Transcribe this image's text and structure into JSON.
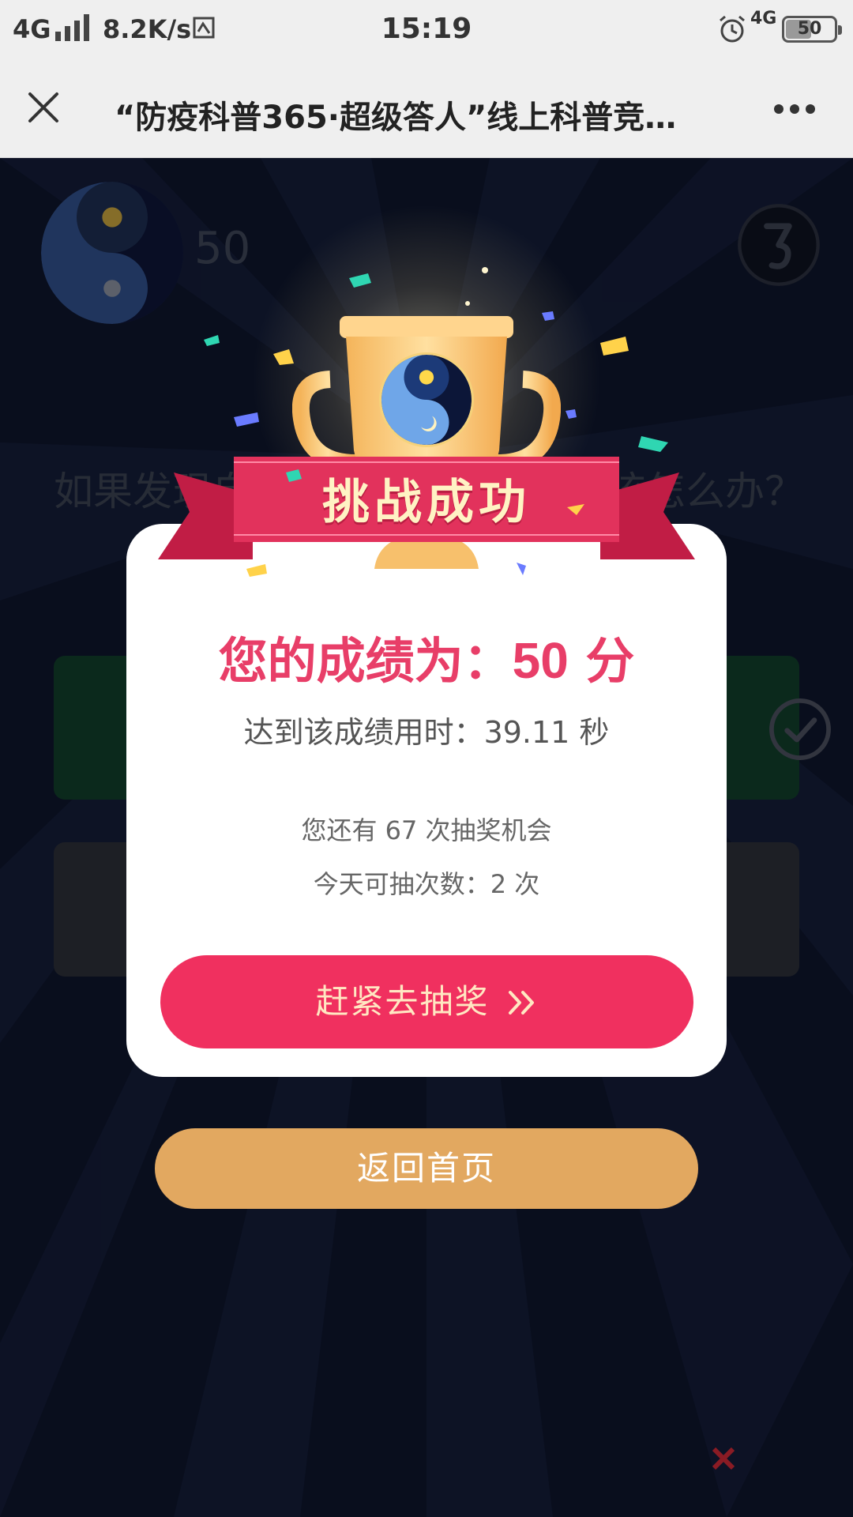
{
  "status_bar": {
    "network": "4G",
    "speed": "8.2K/s",
    "time": "15:19",
    "network_right": "4G",
    "battery": "50"
  },
  "nav": {
    "title": "“防疫科普365·超级答人”线上科普竞…"
  },
  "background": {
    "score": "50",
    "question": "如果发现自己可能感染新冠病毒该怎么办？"
  },
  "modal": {
    "banner": "挑战成功",
    "score_prefix": "您的成绩为：",
    "score_value": "50",
    "score_unit": "分",
    "time_text": "达到该成绩用时：39.11 秒",
    "chances_text": "您还有 67 次抽奖机会",
    "today_text": "今天可抽次数：2 次",
    "draw_button": "赶紧去抽奖",
    "home_button": "返回首页"
  },
  "colors": {
    "accent_pink": "#f0305f",
    "score_pink": "#e83e68",
    "home_orange": "#e2a860",
    "ribbon_red": "#e2325c"
  }
}
